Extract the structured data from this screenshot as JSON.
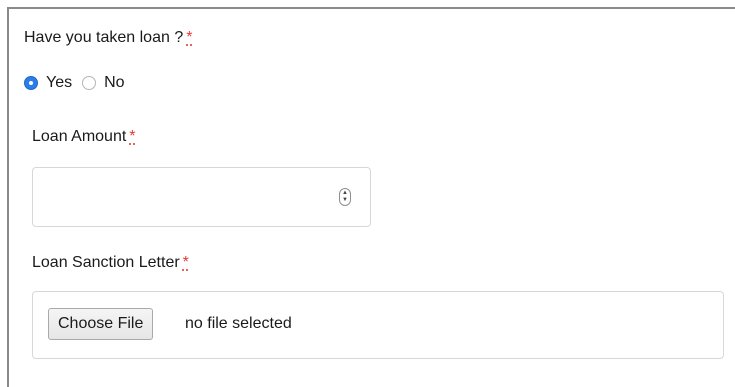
{
  "form": {
    "loan_question": {
      "label": "Have you taken loan ?",
      "required_mark": "*",
      "options": [
        {
          "label": "Yes",
          "selected": true
        },
        {
          "label": "No",
          "selected": false
        }
      ]
    },
    "loan_amount": {
      "label": "Loan Amount",
      "required_mark": "*",
      "value": ""
    },
    "sanction_letter": {
      "label": "Loan Sanction Letter",
      "required_mark": "*",
      "button_label": "Choose File",
      "status_text": "no file selected"
    }
  },
  "colors": {
    "accent": "#2b7de9",
    "required": "#e53935",
    "border": "#d7d7d7"
  }
}
